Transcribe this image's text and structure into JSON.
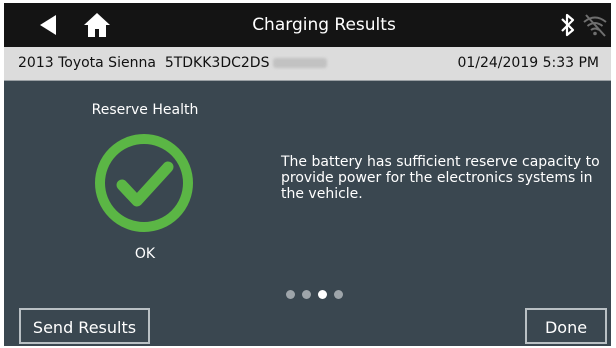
{
  "header": {
    "title": "Charging Results",
    "back_icon": "back-arrow-icon",
    "home_icon": "home-icon",
    "bluetooth_icon": "bluetooth-icon",
    "wifi_icon": "wifi-disconnected-icon"
  },
  "info_bar": {
    "vehicle": "2013 Toyota Sienna",
    "vin_visible": "5TDKK3DC2DS",
    "datetime": "01/24/2019 5:33 PM"
  },
  "reserve": {
    "label": "Reserve Health",
    "status": "OK",
    "status_icon": "check-circle-icon",
    "status_color": "#5bb645",
    "message": "The battery has sufficient reserve capacity to provide power for the electronics systems in the vehicle."
  },
  "pager": {
    "total": 4,
    "active_index": 2
  },
  "actions": {
    "send_label": "Send Results",
    "done_label": "Done"
  }
}
